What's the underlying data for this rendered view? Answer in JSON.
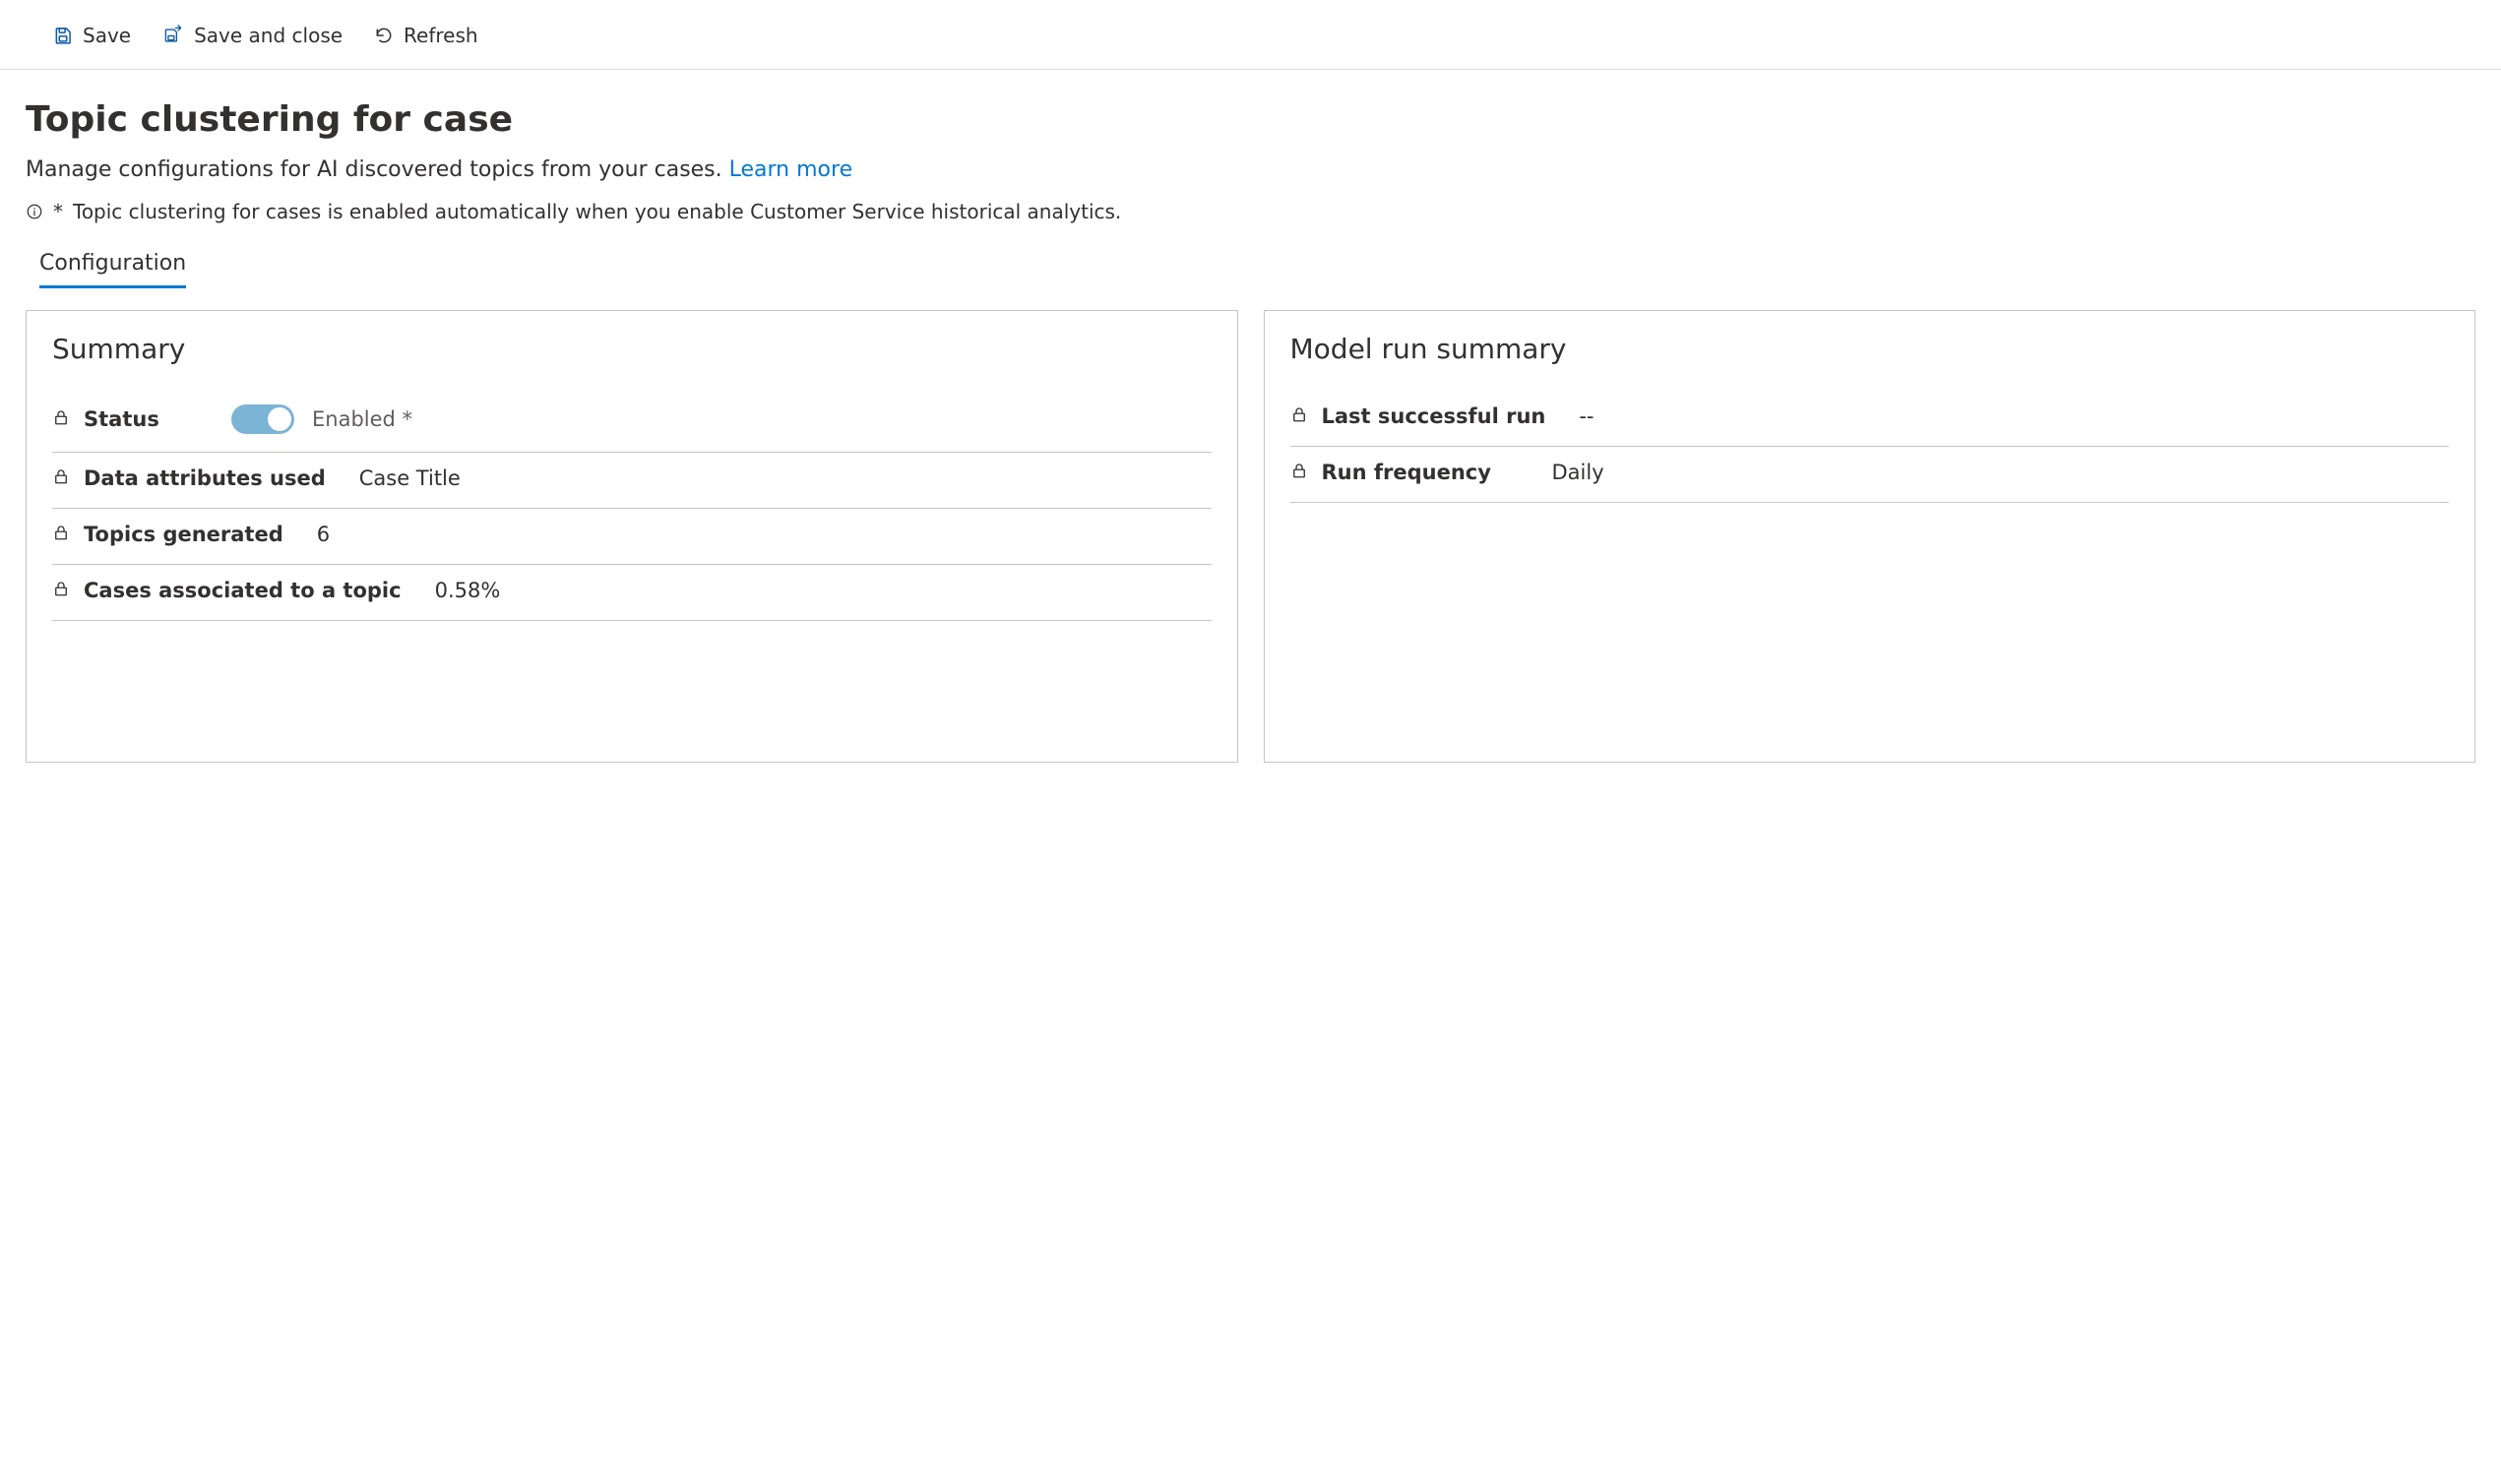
{
  "toolbar": {
    "save_label": "Save",
    "save_close_label": "Save and close",
    "refresh_label": "Refresh"
  },
  "header": {
    "title": "Topic clustering for case",
    "subtitle": "Manage configurations for AI discovered topics from your cases. ",
    "learn_more": "Learn more",
    "info_star": "*",
    "info_text": "Topic clustering for cases is enabled automatically when you enable Customer Service historical analytics."
  },
  "tabs": [
    {
      "label": "Configuration",
      "active": true
    }
  ],
  "summary": {
    "card_title": "Summary",
    "status_label": "Status",
    "status_text": "Enabled *",
    "status_enabled": true,
    "data_attrs_label": "Data attributes used",
    "data_attrs_value": "Case Title",
    "topics_label": "Topics generated",
    "topics_value": "6",
    "cases_assoc_label": "Cases associated to a topic",
    "cases_assoc_value": "0.58%"
  },
  "model_run": {
    "card_title": "Model run summary",
    "last_run_label": "Last successful run",
    "last_run_value": "--",
    "frequency_label": "Run frequency",
    "frequency_value": "Daily"
  },
  "colors": {
    "accent": "#0078d4",
    "toggle_bg": "#7cb4d6",
    "border": "#c8c6c4"
  }
}
